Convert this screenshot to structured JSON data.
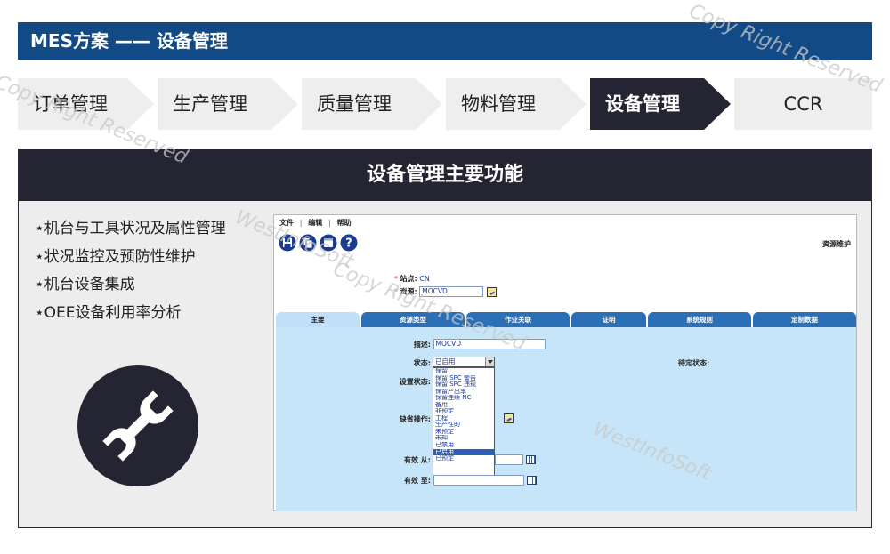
{
  "header": {
    "title": "MES方案 —— 设备管理"
  },
  "tabs": [
    {
      "label": "订单管理",
      "active": false
    },
    {
      "label": "生产管理",
      "active": false
    },
    {
      "label": "质量管理",
      "active": false
    },
    {
      "label": "物料管理",
      "active": false
    },
    {
      "label": "设备管理",
      "active": true
    },
    {
      "label": "CCR",
      "active": false
    }
  ],
  "panel": {
    "title": "设备管理主要功能",
    "features": [
      "⋆机台与工具状况及属性管理",
      "⋆状况监控及预防性维护",
      "⋆机台设备集成",
      "⋆OEE设备利用率分析"
    ],
    "icon": "wrench-icon"
  },
  "app": {
    "menu": [
      "文件",
      "编辑",
      "帮助"
    ],
    "menu_sep": "|",
    "toolbar_icons": [
      "save-icon",
      "copy-icon",
      "new-icon",
      "help-icon"
    ],
    "page_name": "资源维护",
    "site_label": "站点:",
    "site_value": "CN",
    "resource_label": "资源:",
    "resource_value": "MOCVD",
    "required_mark": "*",
    "tabs": [
      "主要",
      "资源类型",
      "作业关联",
      "证明",
      "系统规则",
      "定制数据"
    ],
    "active_tab": "主要",
    "fields": {
      "desc_label": "描述:",
      "desc_value": "MOCVD",
      "status_label": "状态:",
      "status_value": "已启用",
      "setup_label": "设置状态:",
      "pending_label": "待定状态:",
      "default_op_label": "缺省操作:",
      "valid_from_label": "有效 从:",
      "valid_to_label": "有效 至:"
    },
    "status_options": [
      "保留",
      "保留 SPC 警告",
      "保留 SPC 违规",
      "保留产出率",
      "保留连续 NC",
      "备用",
      "非预定",
      "工程",
      "生产性的",
      "未预定",
      "未知",
      "已禁用",
      "已启用",
      "已预定"
    ],
    "selected_option": "已启用"
  },
  "watermark": [
    "WestInfoSoft",
    "Copy Right Reserved"
  ],
  "colors": {
    "title_bar": "#124a86",
    "dark": "#242432",
    "tab_bg": "#eeeeee",
    "app_tab": "#2b70b6",
    "app_content": "#c7e5f8"
  }
}
